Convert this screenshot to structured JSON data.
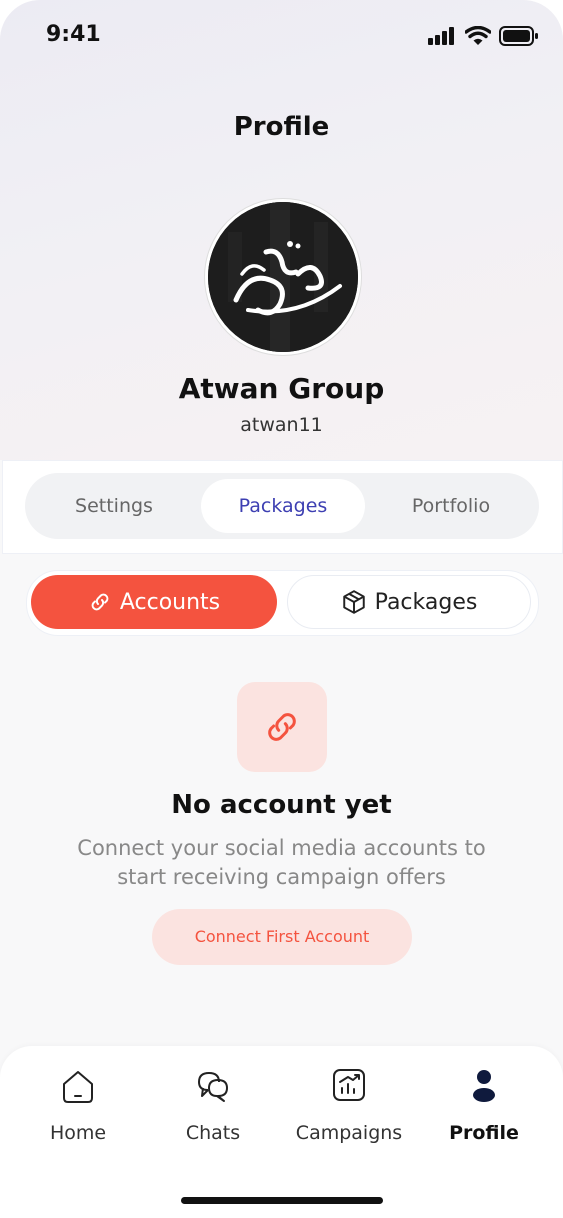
{
  "status_bar": {
    "time": "9:41"
  },
  "header": {
    "title": "Profile"
  },
  "profile": {
    "name": "Atwan Group",
    "username": "atwan11"
  },
  "tabs": [
    {
      "label": "Settings",
      "active": false
    },
    {
      "label": "Packages",
      "active": true
    },
    {
      "label": "Portfolio",
      "active": false
    }
  ],
  "segmented": {
    "accounts_label": "Accounts",
    "packages_label": "Packages",
    "active": "Accounts"
  },
  "empty_state": {
    "title": "No account yet",
    "description": "Connect your social media accounts to start receiving campaign offers",
    "cta_label": "Connect First Account"
  },
  "bottom_nav": {
    "items": [
      {
        "label": "Home",
        "icon": "home-icon",
        "active": false
      },
      {
        "label": "Chats",
        "icon": "chat-icon",
        "active": false
      },
      {
        "label": "Campaigns",
        "icon": "chart-icon",
        "active": false
      },
      {
        "label": "Profile",
        "icon": "user-icon",
        "active": true
      }
    ]
  },
  "colors": {
    "accent": "#f4533f",
    "accent_soft": "#fbe3e0",
    "active_tab_text": "#3d3fb2",
    "nav_active_icon": "#0f1a3d"
  }
}
